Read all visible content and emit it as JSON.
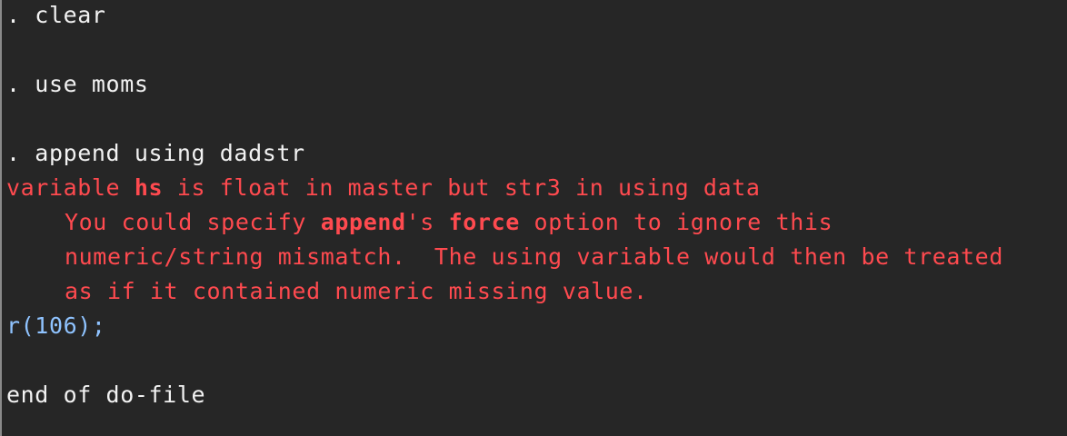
{
  "console": {
    "commands": {
      "clear": ". clear",
      "use": ". use moms",
      "append": ". append using dadstr"
    },
    "error": {
      "line1_prefix": "variable ",
      "line1_var": "hs",
      "line1_suffix": " is float in master but str3 in using data",
      "line2_prefix": "You could specify ",
      "line2_cmd": "append",
      "line2_mid": "'s ",
      "line2_opt": "force",
      "line2_suffix": " option to ignore this",
      "line3": "numeric/string mismatch.  The using variable would then be treated",
      "line4": "as if it contained numeric missing value."
    },
    "return_code": "r(106);",
    "end_message": "end of do-file"
  },
  "colors": {
    "background": "#262626",
    "command_text": "#f2f2f2",
    "error_text": "#ff4a4f",
    "return_code": "#8fc3ff"
  }
}
